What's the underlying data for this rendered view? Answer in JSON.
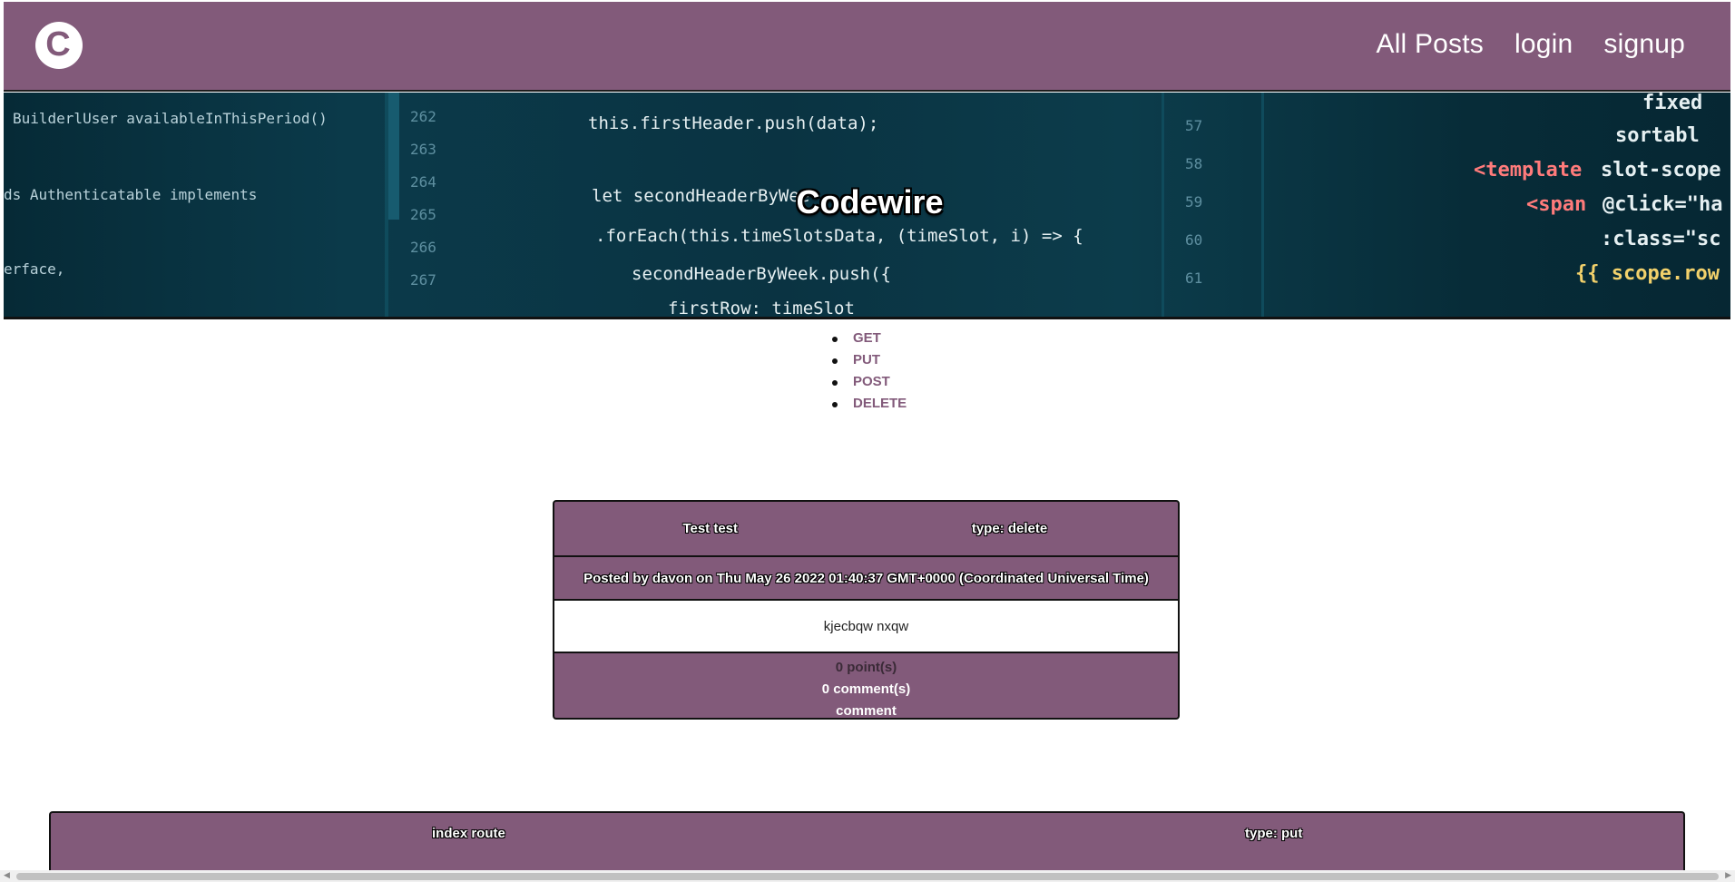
{
  "navbar": {
    "logo_letter": "C",
    "links": [
      "All Posts",
      "login",
      "signup"
    ]
  },
  "hero": {
    "title": "Codewire"
  },
  "methods": [
    "GET",
    "PUT",
    "POST",
    "DELETE"
  ],
  "posts": [
    {
      "title": "Test test",
      "type": "type: delete",
      "meta": "Posted by davon on Thu May 26 2022 01:40:37 GMT+0000 (Coordinated Universal Time)",
      "body": "kjecbqw nxqw",
      "points": "0 point(s)",
      "comments": "0 comment(s)",
      "comment_link": "comment"
    },
    {
      "title": "index route",
      "type": "type: put"
    }
  ],
  "colors": {
    "brand": "#825a7a",
    "hero_bg": "#0a3342"
  }
}
